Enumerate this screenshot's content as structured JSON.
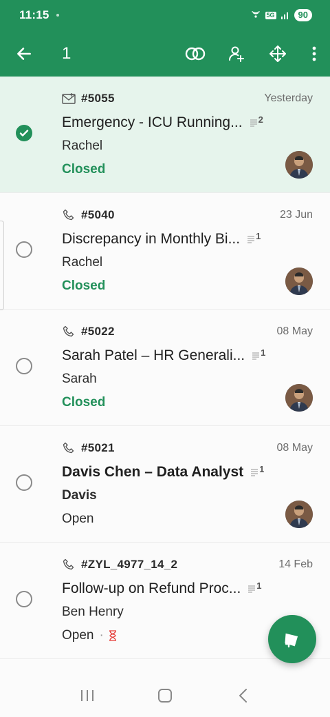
{
  "status_bar": {
    "time": "11:15",
    "network": "5G",
    "battery": "90"
  },
  "app_bar": {
    "selection_count": "1"
  },
  "tickets": [
    {
      "id": "#5055",
      "date": "Yesterday",
      "subject": "Emergency - ICU Running...",
      "notes": "2",
      "requester": "Rachel",
      "status": "Closed",
      "source": "email",
      "selected": true,
      "bold": false
    },
    {
      "id": "#5040",
      "date": "23 Jun",
      "subject": "Discrepancy in Monthly Bi...",
      "notes": "1",
      "requester": "Rachel",
      "status": "Closed",
      "source": "phone",
      "selected": false,
      "bold": false
    },
    {
      "id": "#5022",
      "date": "08 May",
      "subject": "Sarah Patel – HR Generali...",
      "notes": "1",
      "requester": "Sarah",
      "status": "Closed",
      "source": "phone",
      "selected": false,
      "bold": false
    },
    {
      "id": "#5021",
      "date": "08 May",
      "subject": "Davis Chen – Data Analyst",
      "notes": "1",
      "requester": "Davis",
      "status": "Open",
      "source": "phone",
      "selected": false,
      "bold": true
    },
    {
      "id": "#ZYL_4977_14_2",
      "date": "14 Feb",
      "subject": "Follow-up on Refund Proc...",
      "notes": "1",
      "requester": "Ben Henry",
      "status": "Open",
      "source": "phone",
      "selected": false,
      "bold": false,
      "sla": "·"
    }
  ],
  "colors": {
    "primary": "#22905a",
    "selected_row": "#e6f4ec",
    "overdue": "#e53935"
  }
}
